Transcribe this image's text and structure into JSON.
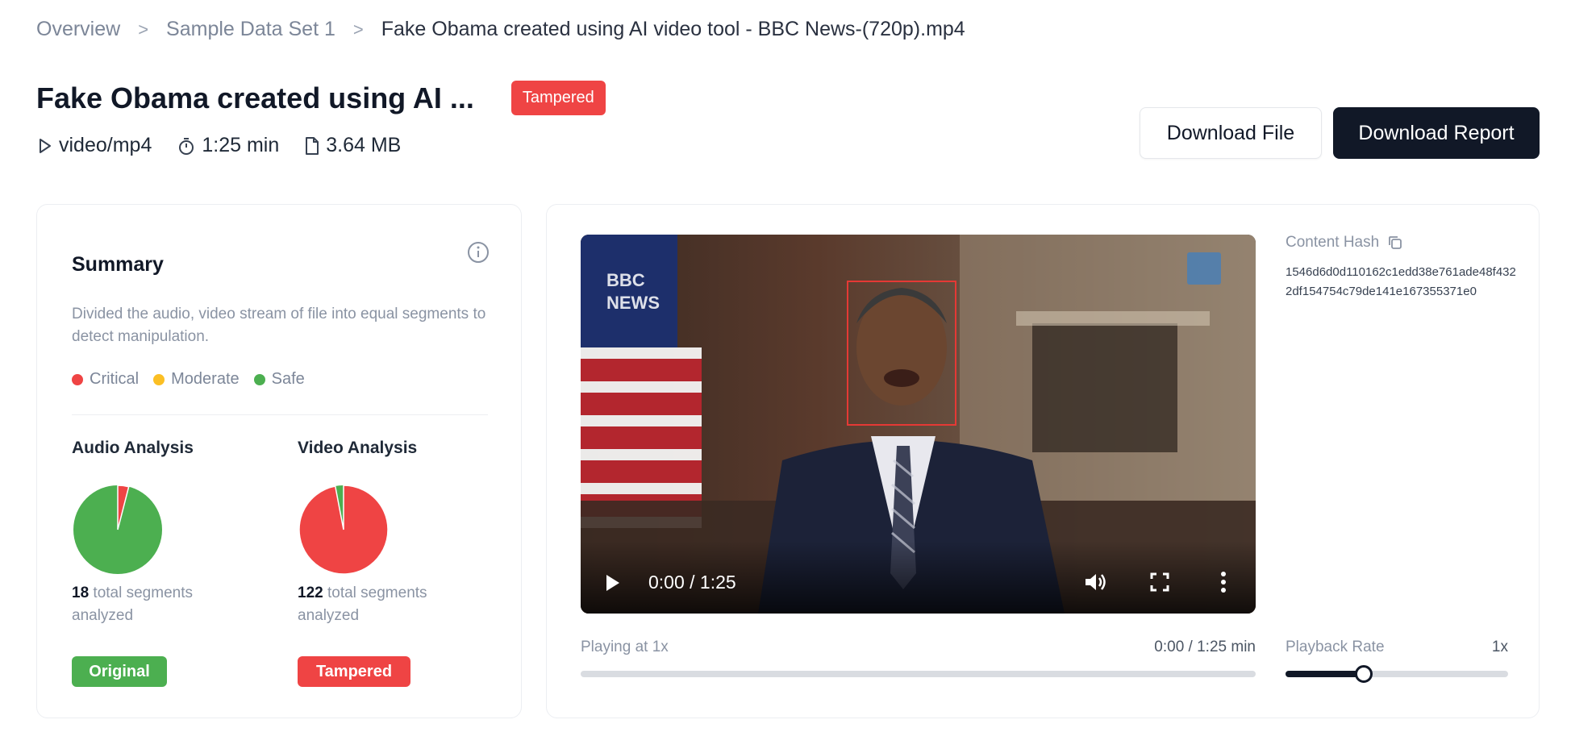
{
  "breadcrumb": {
    "items": [
      "Overview",
      "Sample Data Set 1"
    ],
    "current": "Fake Obama created using AI video tool - BBC News-(720p).mp4",
    "separator": ">"
  },
  "header": {
    "title": "Fake Obama created using AI ...",
    "status_badge": "Tampered",
    "meta": {
      "type": "video/mp4",
      "duration": "1:25 min",
      "size": "3.64 MB"
    },
    "download_file_label": "Download File",
    "download_report_label": "Download Report"
  },
  "summary": {
    "title": "Summary",
    "description": "Divided the audio, video stream of file into equal segments to detect manipulation.",
    "legend": [
      {
        "label": "Critical",
        "color": "#ef4444"
      },
      {
        "label": "Moderate",
        "color": "#fbbf24"
      },
      {
        "label": "Safe",
        "color": "#4caf50"
      }
    ],
    "audio": {
      "title": "Audio Analysis",
      "count": "18",
      "count_suffix": "total segments analyzed",
      "badge": "Original",
      "critical_fraction": 0.04,
      "safe_fraction": 0.96
    },
    "video": {
      "title": "Video Analysis",
      "count": "122",
      "count_suffix": "total segments analyzed",
      "badge": "Tampered",
      "critical_fraction": 0.97,
      "safe_fraction": 0.03
    }
  },
  "player": {
    "time": "0:00 / 1:25",
    "playing_label": "Playing at 1x",
    "playing_time": "0:00 / 1:25 min",
    "progress": 0,
    "channel_logo_text": [
      "BBC",
      "NEWS"
    ]
  },
  "hash": {
    "label": "Content Hash",
    "value": "1546d6d0d110162c1edd38e761ade48f4322df154754c79de141e167355371e0"
  },
  "playback_rate": {
    "label": "Playback Rate",
    "value": "1x",
    "level": 0.35
  },
  "colors": {
    "critical": "#ef4444",
    "safe": "#4caf50",
    "primary_dark": "#111827"
  }
}
